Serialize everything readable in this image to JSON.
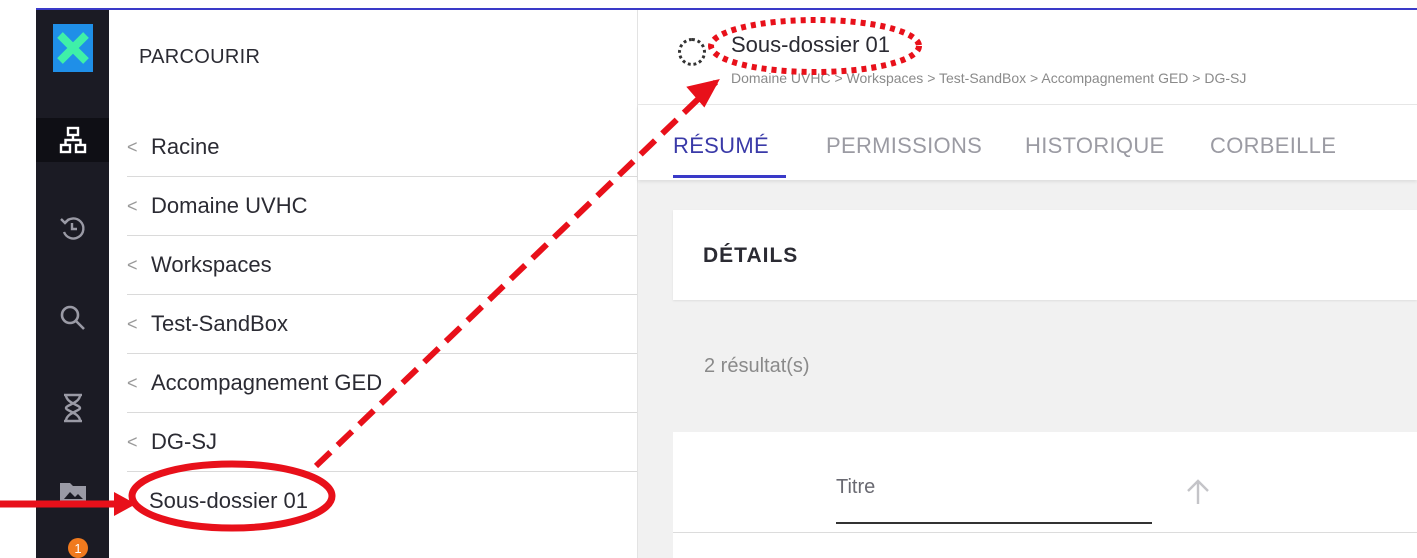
{
  "sidebar": {
    "icons": [
      "logo-x-icon",
      "browse-tree-icon",
      "history-icon",
      "search-icon",
      "hourglass-icon",
      "folder-images-icon"
    ],
    "badge_count": "1"
  },
  "browse": {
    "title": "PARCOURIR",
    "items": [
      {
        "label": "Racine"
      },
      {
        "label": "Domaine UVHC"
      },
      {
        "label": "Workspaces"
      },
      {
        "label": "Test-SandBox"
      },
      {
        "label": "Accompagnement GED"
      },
      {
        "label": "DG-SJ"
      }
    ],
    "current": "Sous-dossier 01"
  },
  "header": {
    "title": "Sous-dossier 01",
    "breadcrumb": "Domaine UVHC > Workspaces > Test-SandBox > Accompagnement GED > DG-SJ"
  },
  "tabs": [
    "RÉSUMÉ",
    "PERMISSIONS",
    "HISTORIQUE",
    "CORBEILLE"
  ],
  "details": {
    "heading": "DÉTAILS",
    "results": "2 résultat(s)",
    "column_title": "Titre"
  },
  "colors": {
    "accent": "#3a3ac8",
    "annotation": "#e8101a",
    "rail": "#1b1b24",
    "logo": "#1f8fe8",
    "badge": "#f07a1e"
  }
}
